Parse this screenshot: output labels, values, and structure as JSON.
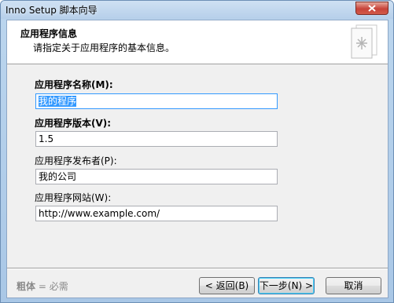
{
  "window": {
    "title": "Inno Setup 脚本向导"
  },
  "header": {
    "title": "应用程序信息",
    "subtitle": "请指定关于应用程序的基本信息。",
    "icon": "document-wizard-icon"
  },
  "fields": {
    "app_name": {
      "label": "应用程序名称(M):",
      "value": "我的程序",
      "required": true
    },
    "app_version": {
      "label": "应用程序版本(V):",
      "value": "1.5",
      "required": true
    },
    "publisher": {
      "label": "应用程序发布者(P):",
      "value": "我的公司",
      "required": false
    },
    "website": {
      "label": "应用程序网站(W):",
      "value": "http://www.example.com/",
      "required": false
    }
  },
  "footer": {
    "note_bold": "粗体",
    "note_rest": " = 必需",
    "back_label": "< 返回(B)",
    "next_label": "下一步(N) >",
    "cancel_label": "取消"
  },
  "colors": {
    "selection": "#3399ff",
    "close": "#c7433a"
  }
}
